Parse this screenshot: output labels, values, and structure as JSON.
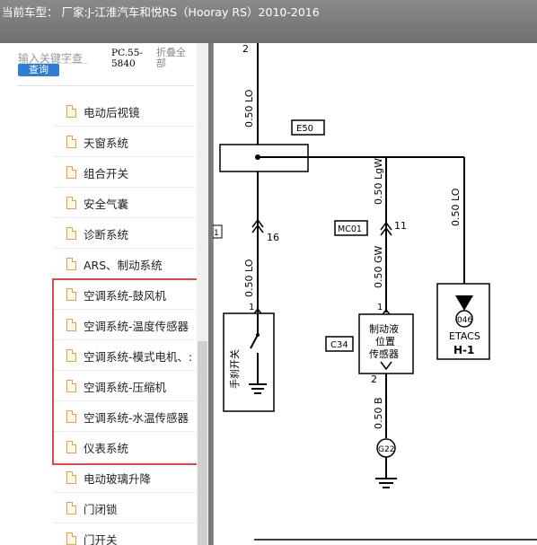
{
  "title": "当前车型：  厂家:J-江淮汽车和悦RS（Hooray RS）2010-2016",
  "sidebar": {
    "search_placeholder": "输入关键字查",
    "search_button": "查询",
    "model_code": "PC.55-\n5840",
    "collapse_all": "折叠全部",
    "items": [
      {
        "label": "电动后视镜"
      },
      {
        "label": "天窗系统"
      },
      {
        "label": "组合开关"
      },
      {
        "label": "安全气囊"
      },
      {
        "label": "诊断系统"
      },
      {
        "label": "ARS、制动系统"
      },
      {
        "label": "空调系统-鼓风机"
      },
      {
        "label": "空调系统-温度传感器"
      },
      {
        "label": "空调系统-模式电机、:"
      },
      {
        "label": "空调系统-压缩机"
      },
      {
        "label": "空调系统-水温传感器"
      },
      {
        "label": "仪表系统"
      },
      {
        "label": "电动玻璃升降"
      },
      {
        "label": "门闭锁"
      },
      {
        "label": "门开关"
      }
    ]
  },
  "diagram": {
    "wire_top": "2",
    "wire_050lo_1": "0.50 LO",
    "e50": "E50",
    "wire_050lgw": "0.50 LgW",
    "wire_050lo_right": "0.50 LO",
    "mc01": "MC01",
    "pin_11": "11",
    "pin_16": "16",
    "left_conn": "1",
    "wire_050lo_2": "0.50 LO",
    "wire_050gw": "0.50 GW",
    "pin_1a": "1",
    "pin_1b": "1",
    "c34": "C34",
    "switch_label": "手刹开关",
    "sensor_label_1": "制动液",
    "sensor_label_2": "位置",
    "sensor_label_3": "传感器",
    "pin_046": "046",
    "etacs": "ETACS",
    "h1": "H-1",
    "pin_2": "2",
    "wire_050b": "0.50 B",
    "g22": "G22"
  }
}
